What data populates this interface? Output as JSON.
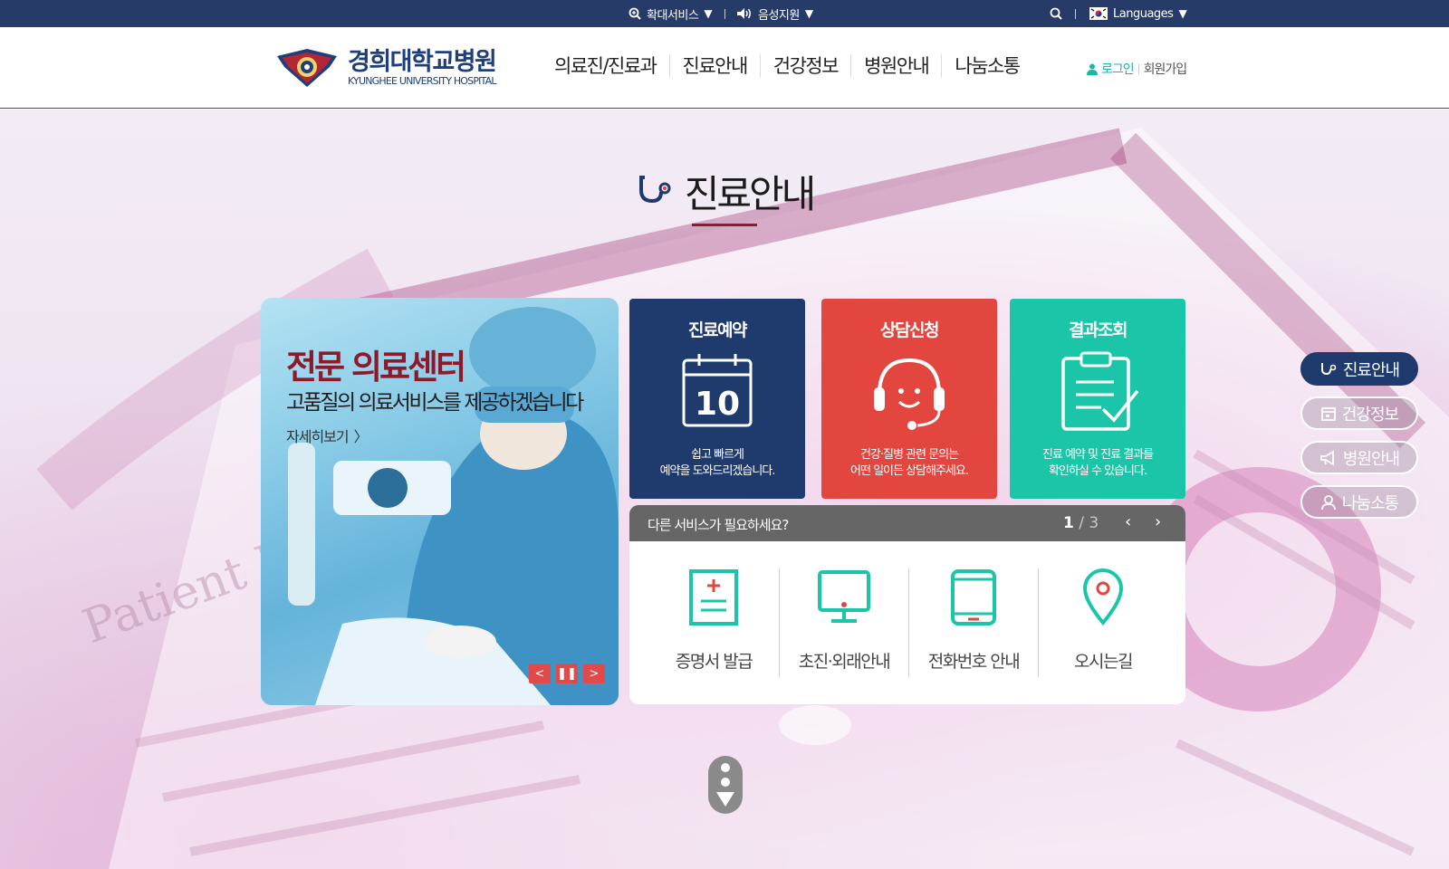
{
  "topbar": {
    "zoom_label": "확대서비스",
    "voice_label": "음성지원",
    "languages_label": "Languages"
  },
  "header": {
    "logo_kr": "경희대학교병원",
    "logo_en": "KYUNGHEE UNIVERSITY HOSPITAL",
    "nav": [
      "의료진/진료과",
      "진료안내",
      "건강정보",
      "병원안내",
      "나눔소통"
    ],
    "login": "로그인",
    "join": "회원가입"
  },
  "section": {
    "title": "진료안내"
  },
  "banner": {
    "heading": "전문 의료센터",
    "subheading": "고품질의 의료서비스를 제공하겠습니다",
    "more": "자세히보기"
  },
  "cards": [
    {
      "title": "진료예약",
      "icon_number": "10",
      "desc": "쉽고 빠르게\n예약을 도와드리겠습니다.",
      "color": "#1f3a6d"
    },
    {
      "title": "상담신청",
      "desc": "건강·질병 관련 문의는\n어떤 일이든 상담해주세요.",
      "color": "#e2463f"
    },
    {
      "title": "결과조회",
      "desc": "진료 예약 및 진료 결과를\n확인하실 수 있습니다.",
      "color": "#1bc6a8"
    }
  ],
  "more_services": {
    "question": "다른 서비스가 필요하세요?",
    "page_current": "1",
    "page_total": "/ 3",
    "items": [
      "증명서 발급",
      "초진·외래안내",
      "전화번호 안내",
      "오시는길"
    ]
  },
  "quick_menu": [
    "진료안내",
    "건강정보",
    "병원안내",
    "나눔소통"
  ],
  "colors": {
    "navy": "#263b68",
    "accent_red": "#8d1a2a",
    "teal": "#1bc6a8"
  }
}
